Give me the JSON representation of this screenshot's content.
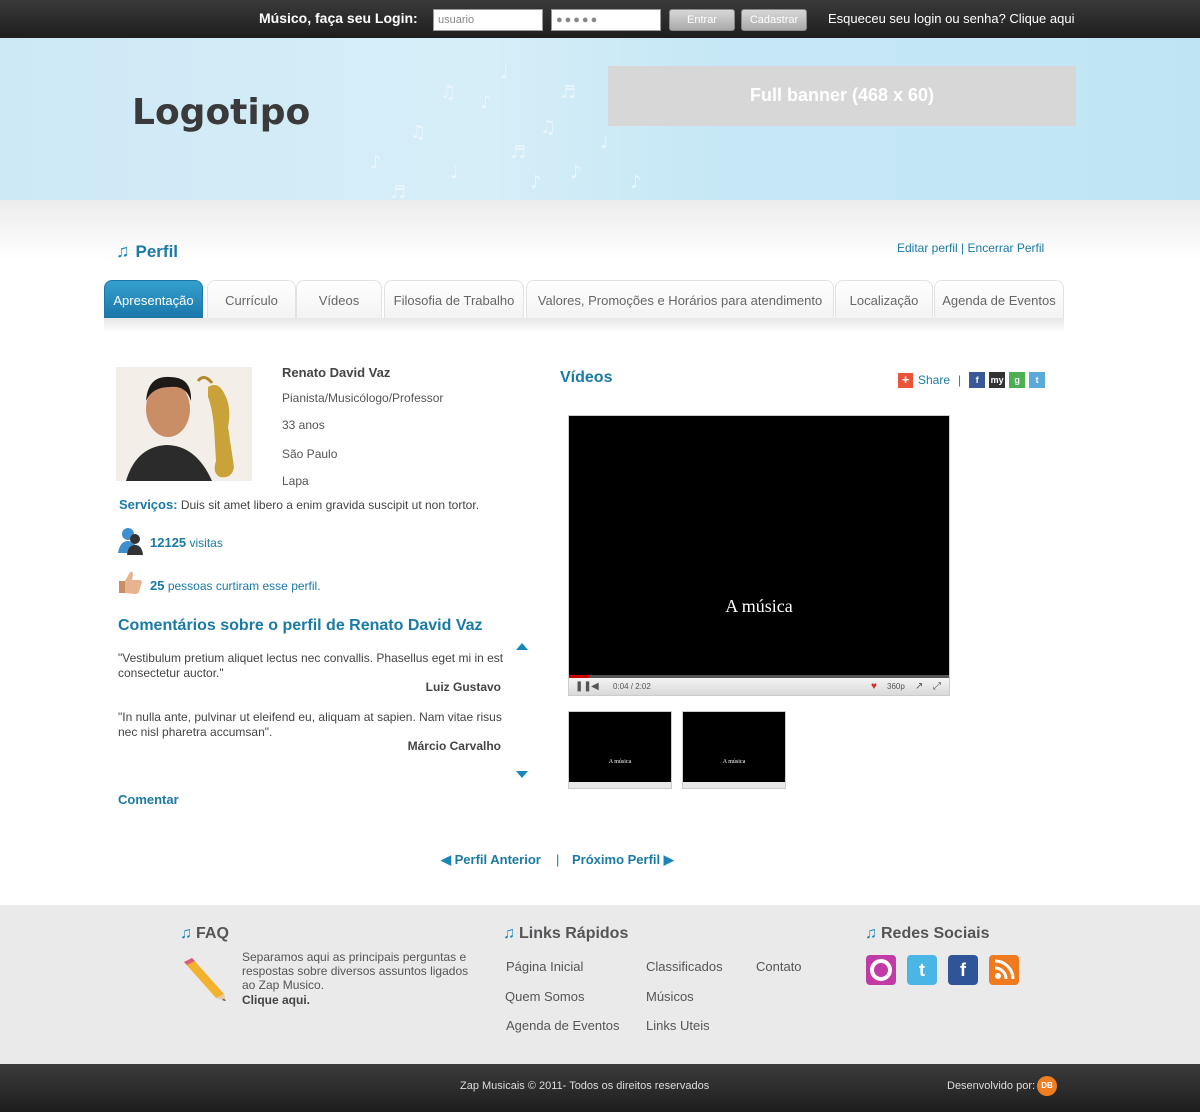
{
  "topbar": {
    "login_label": "Músico, faça seu Login:",
    "username_value": "usuario",
    "password_value": "●●●●●",
    "enter_label": "Entrar",
    "register_label": "Cadastrar",
    "forgot_text": "Esqueceu seu login ou senha? Clique aqui"
  },
  "header": {
    "logo": "Logotipo",
    "banner": "Full banner (468 x 60)"
  },
  "profile": {
    "section_title": "Perfil",
    "edit_link": "Editar perfil",
    "separator": "|",
    "close_link": "Encerrar Perfil"
  },
  "tabs": [
    {
      "label": "Apresentação",
      "active": true
    },
    {
      "label": "Currículo"
    },
    {
      "label": "Vídeos"
    },
    {
      "label": "Filosofia de Trabalho"
    },
    {
      "label": "Valores, Promoções e Horários para atendimento"
    },
    {
      "label": "Localização"
    },
    {
      "label": "Agenda de Eventos"
    }
  ],
  "person": {
    "name": "Renato David Vaz",
    "occupation": "Pianista/Musicólogo/Professor",
    "age": "33 anos",
    "city": "São Paulo",
    "district": "Lapa",
    "services_label": "Serviços:",
    "services_text": "Duis sit amet libero a enim gravida suscipit ut non tortor.",
    "visits_count": "12125",
    "visits_label": "visitas",
    "likes_count": "25",
    "likes_label": "pessoas curtiram esse perfil."
  },
  "comments": {
    "title": "Comentários sobre o perfil de Renato David Vaz",
    "items": [
      {
        "text": "\"Vestibulum pretium aliquet lectus nec convallis. Phasellus eget mi in est consectetur auctor.\"",
        "author": "Luiz Gustavo"
      },
      {
        "text": "\"In nulla ante, pulvinar ut eleifend eu, aliquam at sapien. Nam vitae risus nec nisl pharetra accumsan\".",
        "author": "Márcio Carvalho"
      }
    ],
    "comment_link": "Comentar"
  },
  "videos": {
    "title": "Vídeos",
    "share_label": "Share",
    "share_sep": "|",
    "video_caption": "A música",
    "time": "0:04 / 2:02",
    "quality": "360p",
    "thumb_caption": "A música"
  },
  "pager": {
    "prev": "Perfil Anterior",
    "separator": "|",
    "next": "Próximo Perfil"
  },
  "footer": {
    "faq_title": "FAQ",
    "faq_text": "Separamos aqui as principais perguntas e respostas sobre diversos assuntos ligados ao Zap Musico.",
    "faq_click": "Clique aqui.",
    "links_title": "Links Rápidos",
    "links": [
      "Página Inicial",
      "Classificados",
      "Contato",
      "Quem Somos",
      "Músicos",
      "Agenda de Eventos",
      "Links Uteis"
    ],
    "social_title": "Redes Sociais",
    "copyright": "Zap Musicais © 2011- Todos os direitos reservados",
    "developed_by": "Desenvolvido por:"
  }
}
